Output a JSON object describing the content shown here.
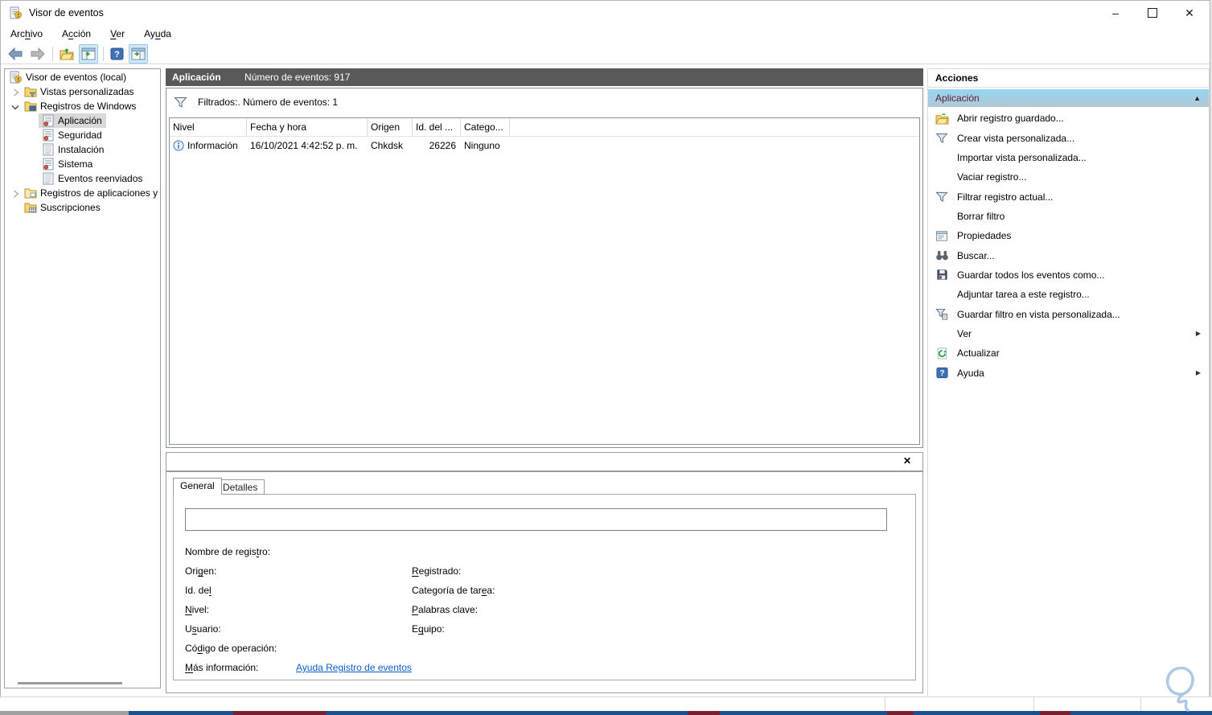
{
  "icons": {
    "minimize": "–",
    "close": "✕",
    "preview_close": "✕",
    "collapse_arrow": "▲",
    "submenu_arrow": "▶"
  },
  "window": {
    "title": "Visor de eventos"
  },
  "menu": {
    "items": [
      {
        "pre": "Arc",
        "accel": "h",
        "post": "ivo"
      },
      {
        "pre": "A",
        "accel": "c",
        "post": "ción"
      },
      {
        "pre": "",
        "accel": "V",
        "post": "er"
      },
      {
        "pre": "Ay",
        "accel": "u",
        "post": "da"
      }
    ]
  },
  "toolbar": {
    "buttons": [
      "back",
      "forward",
      "open-saved-log",
      "toggle-console-tree",
      "help",
      "toggle-action-pane"
    ]
  },
  "tree": {
    "items": [
      {
        "label": "Visor de eventos (local)"
      },
      {
        "label": "Vistas personalizadas"
      },
      {
        "label": "Registros de Windows"
      },
      {
        "label": "Aplicación"
      },
      {
        "label": "Seguridad"
      },
      {
        "label": "Instalación"
      },
      {
        "label": "Sistema"
      },
      {
        "label": "Eventos reenviados"
      },
      {
        "label": "Registros de aplicaciones y s"
      },
      {
        "label": "Suscripciones"
      }
    ]
  },
  "main": {
    "log_name": "Aplicación",
    "event_count_label": "Número de eventos: 917",
    "filter_status": "Filtrados:. Número de eventos: 1",
    "table": {
      "columns": [
        "Nivel",
        "Fecha y hora",
        "Origen",
        "Id. del ...",
        "Catego..."
      ],
      "row": {
        "level": "Información",
        "datetime": "16/10/2021 4:42:52 p. m.",
        "source": "Chkdsk",
        "event_id": "26226",
        "category": "Ninguno"
      }
    },
    "preview": {
      "tabs": [
        "General",
        "Detalles"
      ],
      "fields_left": [
        {
          "pre": "Nombre de regis",
          "accel": "t",
          "post": "ro:"
        },
        {
          "pre": "Ori",
          "accel": "g",
          "post": "en:"
        },
        {
          "pre": "Id. de",
          "accel": "l",
          "post": ""
        },
        {
          "pre": "",
          "accel": "N",
          "post": "ivel:"
        },
        {
          "pre": "U",
          "accel": "s",
          "post": "uario:"
        },
        {
          "pre": "Có",
          "accel": "d",
          "post": "igo de operación:"
        },
        {
          "pre": "",
          "accel": "M",
          "post": "ás información:"
        }
      ],
      "fields_right": [
        {
          "pre": "",
          "accel": "R",
          "post": "egistrado:"
        },
        {
          "pre": "Categoría de tar",
          "accel": "e",
          "post": "a:"
        },
        {
          "pre": "",
          "accel": "P",
          "post": "alabras clave:"
        },
        {
          "pre": "E",
          "accel": "q",
          "post": "uipo:"
        }
      ],
      "help_link": "Ayuda Registro de eventos"
    }
  },
  "actions": {
    "title": "Acciones",
    "group_title": "Aplicación",
    "items": [
      {
        "label": "Abrir registro guardado..."
      },
      {
        "label": "Crear vista personalizada..."
      },
      {
        "label": "Importar vista personalizada..."
      },
      {
        "label": "Vaciar registro..."
      },
      {
        "label": "Filtrar registro actual..."
      },
      {
        "label": "Borrar filtro"
      },
      {
        "label": "Propiedades"
      },
      {
        "label": "Buscar..."
      },
      {
        "label": "Guardar todos los eventos como..."
      },
      {
        "label": "Adjuntar tarea a este registro..."
      },
      {
        "label": "Guardar filtro en vista personalizada..."
      },
      {
        "label": "Ver"
      },
      {
        "label": "Actualizar"
      },
      {
        "label": "Ayuda"
      }
    ]
  },
  "colors": {
    "header_bar": "#595959",
    "group_header_top": "#93d7f2",
    "group_header_bottom": "#b3c7d6",
    "group_header_text": "#63182f",
    "selection_bg": "#d9d9d9",
    "link": "#0b5fcb",
    "toolbar_highlight": "#cfe8fa",
    "toolbar_highlight_border": "#94c9ef",
    "taskbar_blue": "#1b4f8f",
    "taskbar_red": "#7a1f2e",
    "doodle": "#adc9e6"
  }
}
